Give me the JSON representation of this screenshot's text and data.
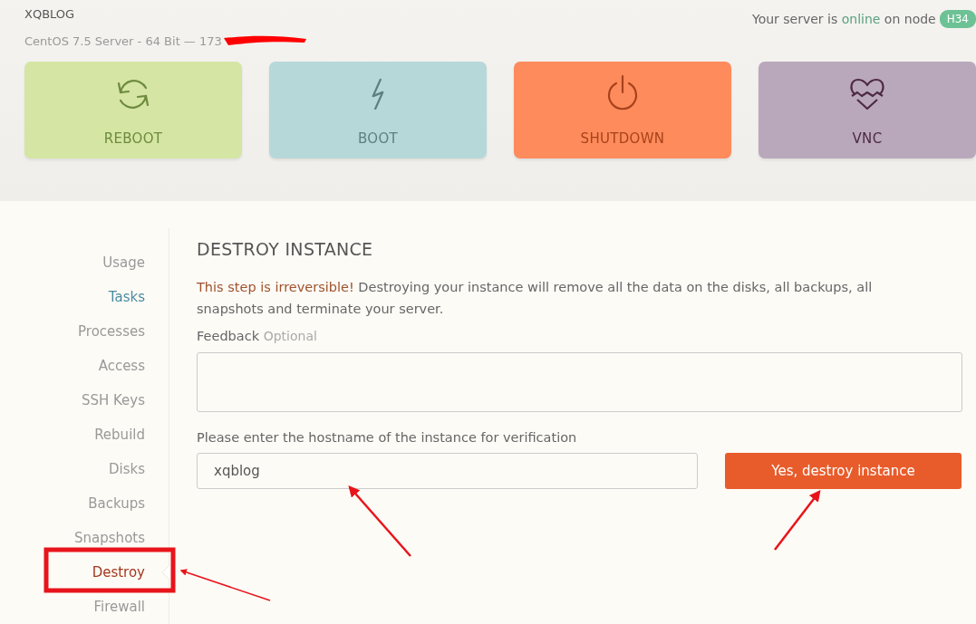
{
  "server": {
    "name": "XQBLOG",
    "subtitle": "CentOS 7.5 Server - 64 Bit — 173",
    "status_prefix": "Your server is",
    "status": "online",
    "status_suffix": "on node",
    "node": "H34"
  },
  "actions": [
    {
      "kind": "reboot",
      "label": "REBOOT"
    },
    {
      "kind": "boot",
      "label": "BOOT"
    },
    {
      "kind": "shutdown",
      "label": "SHUTDOWN"
    },
    {
      "kind": "vnc",
      "label": "VNC"
    }
  ],
  "sidebar": {
    "items": [
      {
        "label": "Usage",
        "selected": false,
        "hovered": false
      },
      {
        "label": "Tasks",
        "selected": false,
        "hovered": true
      },
      {
        "label": "Processes",
        "selected": false,
        "hovered": false
      },
      {
        "label": "Access",
        "selected": false,
        "hovered": false
      },
      {
        "label": "SSH Keys",
        "selected": false,
        "hovered": false
      },
      {
        "label": "Rebuild",
        "selected": false,
        "hovered": false
      },
      {
        "label": "Disks",
        "selected": false,
        "hovered": false
      },
      {
        "label": "Backups",
        "selected": false,
        "hovered": false
      },
      {
        "label": "Snapshots",
        "selected": false,
        "hovered": false
      },
      {
        "label": "Destroy",
        "selected": true,
        "hovered": false
      },
      {
        "label": "Firewall",
        "selected": false,
        "hovered": false
      }
    ]
  },
  "panel": {
    "title": "DESTROY INSTANCE",
    "warning": {
      "emphasis": "This step is irreversible!",
      "text": "Destroying your instance will remove all the data on the disks, all backups, all snapshots and terminate your server."
    },
    "feedback": {
      "label": "Feedback",
      "hint": "Optional"
    },
    "hostname": {
      "label": "Please enter the hostname of the instance for verification",
      "value": "xqblog"
    },
    "button": "Yes, destroy instance"
  },
  "annotations": [
    {
      "kind": "scribble"
    },
    {
      "kind": "box"
    },
    {
      "kind": "arrow"
    },
    {
      "kind": "arrow"
    },
    {
      "kind": "arrow"
    }
  ]
}
